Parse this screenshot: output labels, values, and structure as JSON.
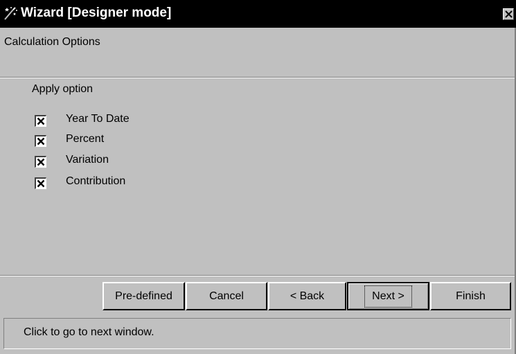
{
  "window": {
    "title": "Wizard  [Designer mode]",
    "icon": "wizard-wand-icon",
    "close_icon": "close-icon"
  },
  "header": {
    "text": "Calculation Options"
  },
  "group": {
    "label": "Apply option",
    "options": [
      {
        "label": "Year To Date",
        "checked": true
      },
      {
        "label": "Percent",
        "checked": true
      },
      {
        "label": "Variation",
        "checked": true
      },
      {
        "label": "Contribution",
        "checked": true
      }
    ]
  },
  "buttons": {
    "predefined": "Pre-defined",
    "cancel": "Cancel",
    "back": "< Back",
    "next": "Next >",
    "finish": "Finish"
  },
  "status": {
    "text": "Click to go to next window."
  },
  "colors": {
    "face": "#c0c0c0",
    "titlebar": "#000000",
    "title_text": "#ffffff"
  }
}
